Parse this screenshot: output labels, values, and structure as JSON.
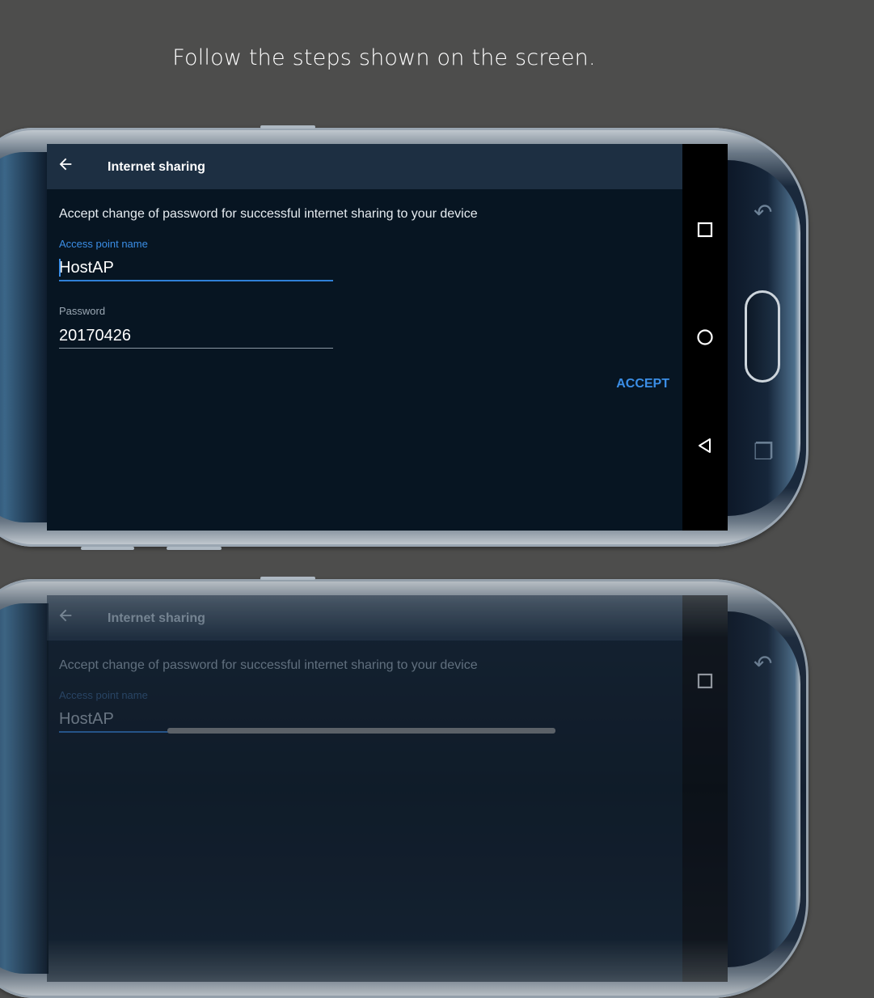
{
  "caption": "Follow the steps shown on the screen.",
  "app": {
    "title": "Internet sharing",
    "instruction": "Accept change of password for successful internet sharing to your device",
    "ap_label": "Access point name",
    "ap_value": "HostAP",
    "password_label": "Password",
    "password_value": "20170426",
    "accept_label": "ACCEPT"
  },
  "navbar": {
    "icons": [
      "recent-apps-icon",
      "home-icon",
      "back-icon"
    ]
  },
  "colors": {
    "accent": "#3b8ee6",
    "screen_bg": "#071522",
    "appbar_bg": "#1d2f42",
    "page_bg": "#4d4d4c"
  }
}
